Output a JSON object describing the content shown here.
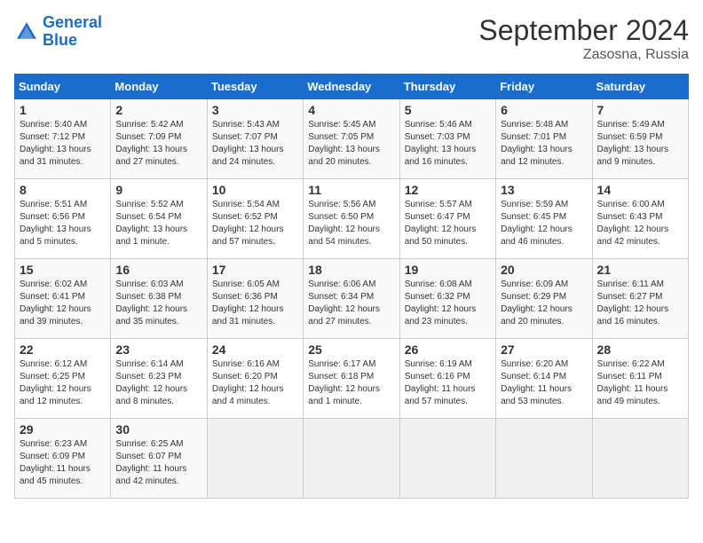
{
  "logo": {
    "line1": "General",
    "line2": "Blue"
  },
  "title": "September 2024",
  "location": "Zasosna, Russia",
  "weekdays": [
    "Sunday",
    "Monday",
    "Tuesday",
    "Wednesday",
    "Thursday",
    "Friday",
    "Saturday"
  ],
  "days": [
    {
      "num": "",
      "detail": ""
    },
    {
      "num": "2",
      "detail": "Sunrise: 5:42 AM\nSunset: 7:09 PM\nDaylight: 13 hours\nand 27 minutes."
    },
    {
      "num": "3",
      "detail": "Sunrise: 5:43 AM\nSunset: 7:07 PM\nDaylight: 13 hours\nand 24 minutes."
    },
    {
      "num": "4",
      "detail": "Sunrise: 5:45 AM\nSunset: 7:05 PM\nDaylight: 13 hours\nand 20 minutes."
    },
    {
      "num": "5",
      "detail": "Sunrise: 5:46 AM\nSunset: 7:03 PM\nDaylight: 13 hours\nand 16 minutes."
    },
    {
      "num": "6",
      "detail": "Sunrise: 5:48 AM\nSunset: 7:01 PM\nDaylight: 13 hours\nand 12 minutes."
    },
    {
      "num": "7",
      "detail": "Sunrise: 5:49 AM\nSunset: 6:59 PM\nDaylight: 13 hours\nand 9 minutes."
    },
    {
      "num": "8",
      "detail": "Sunrise: 5:51 AM\nSunset: 6:56 PM\nDaylight: 13 hours\nand 5 minutes."
    },
    {
      "num": "9",
      "detail": "Sunrise: 5:52 AM\nSunset: 6:54 PM\nDaylight: 13 hours\nand 1 minute."
    },
    {
      "num": "10",
      "detail": "Sunrise: 5:54 AM\nSunset: 6:52 PM\nDaylight: 12 hours\nand 57 minutes."
    },
    {
      "num": "11",
      "detail": "Sunrise: 5:56 AM\nSunset: 6:50 PM\nDaylight: 12 hours\nand 54 minutes."
    },
    {
      "num": "12",
      "detail": "Sunrise: 5:57 AM\nSunset: 6:47 PM\nDaylight: 12 hours\nand 50 minutes."
    },
    {
      "num": "13",
      "detail": "Sunrise: 5:59 AM\nSunset: 6:45 PM\nDaylight: 12 hours\nand 46 minutes."
    },
    {
      "num": "14",
      "detail": "Sunrise: 6:00 AM\nSunset: 6:43 PM\nDaylight: 12 hours\nand 42 minutes."
    },
    {
      "num": "15",
      "detail": "Sunrise: 6:02 AM\nSunset: 6:41 PM\nDaylight: 12 hours\nand 39 minutes."
    },
    {
      "num": "16",
      "detail": "Sunrise: 6:03 AM\nSunset: 6:38 PM\nDaylight: 12 hours\nand 35 minutes."
    },
    {
      "num": "17",
      "detail": "Sunrise: 6:05 AM\nSunset: 6:36 PM\nDaylight: 12 hours\nand 31 minutes."
    },
    {
      "num": "18",
      "detail": "Sunrise: 6:06 AM\nSunset: 6:34 PM\nDaylight: 12 hours\nand 27 minutes."
    },
    {
      "num": "19",
      "detail": "Sunrise: 6:08 AM\nSunset: 6:32 PM\nDaylight: 12 hours\nand 23 minutes."
    },
    {
      "num": "20",
      "detail": "Sunrise: 6:09 AM\nSunset: 6:29 PM\nDaylight: 12 hours\nand 20 minutes."
    },
    {
      "num": "21",
      "detail": "Sunrise: 6:11 AM\nSunset: 6:27 PM\nDaylight: 12 hours\nand 16 minutes."
    },
    {
      "num": "22",
      "detail": "Sunrise: 6:12 AM\nSunset: 6:25 PM\nDaylight: 12 hours\nand 12 minutes."
    },
    {
      "num": "23",
      "detail": "Sunrise: 6:14 AM\nSunset: 6:23 PM\nDaylight: 12 hours\nand 8 minutes."
    },
    {
      "num": "24",
      "detail": "Sunrise: 6:16 AM\nSunset: 6:20 PM\nDaylight: 12 hours\nand 4 minutes."
    },
    {
      "num": "25",
      "detail": "Sunrise: 6:17 AM\nSunset: 6:18 PM\nDaylight: 12 hours\nand 1 minute."
    },
    {
      "num": "26",
      "detail": "Sunrise: 6:19 AM\nSunset: 6:16 PM\nDaylight: 11 hours\nand 57 minutes."
    },
    {
      "num": "27",
      "detail": "Sunrise: 6:20 AM\nSunset: 6:14 PM\nDaylight: 11 hours\nand 53 minutes."
    },
    {
      "num": "28",
      "detail": "Sunrise: 6:22 AM\nSunset: 6:11 PM\nDaylight: 11 hours\nand 49 minutes."
    },
    {
      "num": "29",
      "detail": "Sunrise: 6:23 AM\nSunset: 6:09 PM\nDaylight: 11 hours\nand 45 minutes."
    },
    {
      "num": "30",
      "detail": "Sunrise: 6:25 AM\nSunset: 6:07 PM\nDaylight: 11 hours\nand 42 minutes."
    },
    {
      "num": "",
      "detail": ""
    },
    {
      "num": "",
      "detail": ""
    },
    {
      "num": "",
      "detail": ""
    },
    {
      "num": "",
      "detail": ""
    },
    {
      "num": "",
      "detail": ""
    }
  ],
  "day1": {
    "num": "1",
    "detail": "Sunrise: 5:40 AM\nSunset: 7:12 PM\nDaylight: 13 hours\nand 31 minutes."
  }
}
